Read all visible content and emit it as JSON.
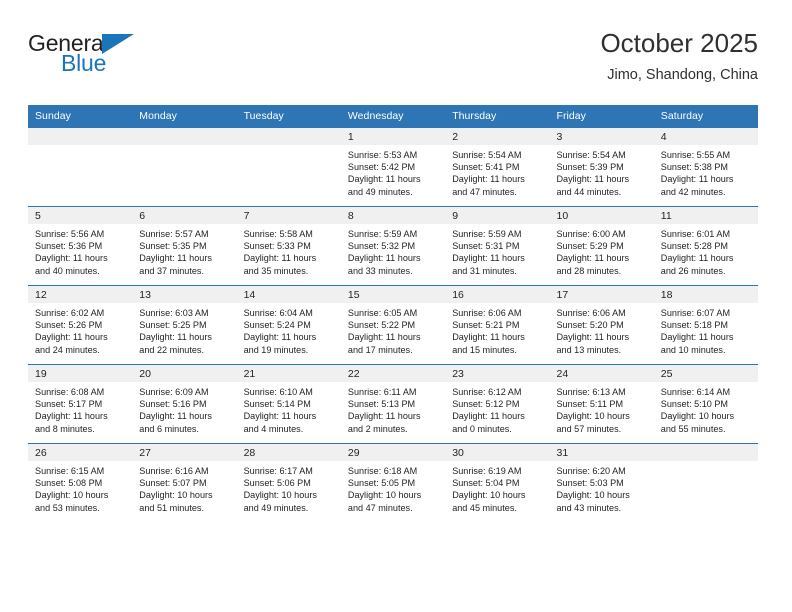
{
  "brand": {
    "name_top": "General",
    "name_bottom": "Blue"
  },
  "header": {
    "title": "October 2025",
    "location": "Jimo, Shandong, China"
  },
  "colors": {
    "header_blue": "#2e75b6",
    "brand_blue": "#1b75bb",
    "daynum_band": "#f0f0f0",
    "text": "#231f20"
  },
  "calendar": {
    "weekday_headers": [
      "Sunday",
      "Monday",
      "Tuesday",
      "Wednesday",
      "Thursday",
      "Friday",
      "Saturday"
    ],
    "weeks": [
      [
        {
          "day": "",
          "sunrise": "",
          "sunset": "",
          "daylight_line1": "",
          "daylight_line2": ""
        },
        {
          "day": "",
          "sunrise": "",
          "sunset": "",
          "daylight_line1": "",
          "daylight_line2": ""
        },
        {
          "day": "",
          "sunrise": "",
          "sunset": "",
          "daylight_line1": "",
          "daylight_line2": ""
        },
        {
          "day": "1",
          "sunrise": "Sunrise: 5:53 AM",
          "sunset": "Sunset: 5:42 PM",
          "daylight_line1": "Daylight: 11 hours",
          "daylight_line2": "and 49 minutes."
        },
        {
          "day": "2",
          "sunrise": "Sunrise: 5:54 AM",
          "sunset": "Sunset: 5:41 PM",
          "daylight_line1": "Daylight: 11 hours",
          "daylight_line2": "and 47 minutes."
        },
        {
          "day": "3",
          "sunrise": "Sunrise: 5:54 AM",
          "sunset": "Sunset: 5:39 PM",
          "daylight_line1": "Daylight: 11 hours",
          "daylight_line2": "and 44 minutes."
        },
        {
          "day": "4",
          "sunrise": "Sunrise: 5:55 AM",
          "sunset": "Sunset: 5:38 PM",
          "daylight_line1": "Daylight: 11 hours",
          "daylight_line2": "and 42 minutes."
        }
      ],
      [
        {
          "day": "5",
          "sunrise": "Sunrise: 5:56 AM",
          "sunset": "Sunset: 5:36 PM",
          "daylight_line1": "Daylight: 11 hours",
          "daylight_line2": "and 40 minutes."
        },
        {
          "day": "6",
          "sunrise": "Sunrise: 5:57 AM",
          "sunset": "Sunset: 5:35 PM",
          "daylight_line1": "Daylight: 11 hours",
          "daylight_line2": "and 37 minutes."
        },
        {
          "day": "7",
          "sunrise": "Sunrise: 5:58 AM",
          "sunset": "Sunset: 5:33 PM",
          "daylight_line1": "Daylight: 11 hours",
          "daylight_line2": "and 35 minutes."
        },
        {
          "day": "8",
          "sunrise": "Sunrise: 5:59 AM",
          "sunset": "Sunset: 5:32 PM",
          "daylight_line1": "Daylight: 11 hours",
          "daylight_line2": "and 33 minutes."
        },
        {
          "day": "9",
          "sunrise": "Sunrise: 5:59 AM",
          "sunset": "Sunset: 5:31 PM",
          "daylight_line1": "Daylight: 11 hours",
          "daylight_line2": "and 31 minutes."
        },
        {
          "day": "10",
          "sunrise": "Sunrise: 6:00 AM",
          "sunset": "Sunset: 5:29 PM",
          "daylight_line1": "Daylight: 11 hours",
          "daylight_line2": "and 28 minutes."
        },
        {
          "day": "11",
          "sunrise": "Sunrise: 6:01 AM",
          "sunset": "Sunset: 5:28 PM",
          "daylight_line1": "Daylight: 11 hours",
          "daylight_line2": "and 26 minutes."
        }
      ],
      [
        {
          "day": "12",
          "sunrise": "Sunrise: 6:02 AM",
          "sunset": "Sunset: 5:26 PM",
          "daylight_line1": "Daylight: 11 hours",
          "daylight_line2": "and 24 minutes."
        },
        {
          "day": "13",
          "sunrise": "Sunrise: 6:03 AM",
          "sunset": "Sunset: 5:25 PM",
          "daylight_line1": "Daylight: 11 hours",
          "daylight_line2": "and 22 minutes."
        },
        {
          "day": "14",
          "sunrise": "Sunrise: 6:04 AM",
          "sunset": "Sunset: 5:24 PM",
          "daylight_line1": "Daylight: 11 hours",
          "daylight_line2": "and 19 minutes."
        },
        {
          "day": "15",
          "sunrise": "Sunrise: 6:05 AM",
          "sunset": "Sunset: 5:22 PM",
          "daylight_line1": "Daylight: 11 hours",
          "daylight_line2": "and 17 minutes."
        },
        {
          "day": "16",
          "sunrise": "Sunrise: 6:06 AM",
          "sunset": "Sunset: 5:21 PM",
          "daylight_line1": "Daylight: 11 hours",
          "daylight_line2": "and 15 minutes."
        },
        {
          "day": "17",
          "sunrise": "Sunrise: 6:06 AM",
          "sunset": "Sunset: 5:20 PM",
          "daylight_line1": "Daylight: 11 hours",
          "daylight_line2": "and 13 minutes."
        },
        {
          "day": "18",
          "sunrise": "Sunrise: 6:07 AM",
          "sunset": "Sunset: 5:18 PM",
          "daylight_line1": "Daylight: 11 hours",
          "daylight_line2": "and 10 minutes."
        }
      ],
      [
        {
          "day": "19",
          "sunrise": "Sunrise: 6:08 AM",
          "sunset": "Sunset: 5:17 PM",
          "daylight_line1": "Daylight: 11 hours",
          "daylight_line2": "and 8 minutes."
        },
        {
          "day": "20",
          "sunrise": "Sunrise: 6:09 AM",
          "sunset": "Sunset: 5:16 PM",
          "daylight_line1": "Daylight: 11 hours",
          "daylight_line2": "and 6 minutes."
        },
        {
          "day": "21",
          "sunrise": "Sunrise: 6:10 AM",
          "sunset": "Sunset: 5:14 PM",
          "daylight_line1": "Daylight: 11 hours",
          "daylight_line2": "and 4 minutes."
        },
        {
          "day": "22",
          "sunrise": "Sunrise: 6:11 AM",
          "sunset": "Sunset: 5:13 PM",
          "daylight_line1": "Daylight: 11 hours",
          "daylight_line2": "and 2 minutes."
        },
        {
          "day": "23",
          "sunrise": "Sunrise: 6:12 AM",
          "sunset": "Sunset: 5:12 PM",
          "daylight_line1": "Daylight: 11 hours",
          "daylight_line2": "and 0 minutes."
        },
        {
          "day": "24",
          "sunrise": "Sunrise: 6:13 AM",
          "sunset": "Sunset: 5:11 PM",
          "daylight_line1": "Daylight: 10 hours",
          "daylight_line2": "and 57 minutes."
        },
        {
          "day": "25",
          "sunrise": "Sunrise: 6:14 AM",
          "sunset": "Sunset: 5:10 PM",
          "daylight_line1": "Daylight: 10 hours",
          "daylight_line2": "and 55 minutes."
        }
      ],
      [
        {
          "day": "26",
          "sunrise": "Sunrise: 6:15 AM",
          "sunset": "Sunset: 5:08 PM",
          "daylight_line1": "Daylight: 10 hours",
          "daylight_line2": "and 53 minutes."
        },
        {
          "day": "27",
          "sunrise": "Sunrise: 6:16 AM",
          "sunset": "Sunset: 5:07 PM",
          "daylight_line1": "Daylight: 10 hours",
          "daylight_line2": "and 51 minutes."
        },
        {
          "day": "28",
          "sunrise": "Sunrise: 6:17 AM",
          "sunset": "Sunset: 5:06 PM",
          "daylight_line1": "Daylight: 10 hours",
          "daylight_line2": "and 49 minutes."
        },
        {
          "day": "29",
          "sunrise": "Sunrise: 6:18 AM",
          "sunset": "Sunset: 5:05 PM",
          "daylight_line1": "Daylight: 10 hours",
          "daylight_line2": "and 47 minutes."
        },
        {
          "day": "30",
          "sunrise": "Sunrise: 6:19 AM",
          "sunset": "Sunset: 5:04 PM",
          "daylight_line1": "Daylight: 10 hours",
          "daylight_line2": "and 45 minutes."
        },
        {
          "day": "31",
          "sunrise": "Sunrise: 6:20 AM",
          "sunset": "Sunset: 5:03 PM",
          "daylight_line1": "Daylight: 10 hours",
          "daylight_line2": "and 43 minutes."
        },
        {
          "day": "",
          "sunrise": "",
          "sunset": "",
          "daylight_line1": "",
          "daylight_line2": ""
        }
      ]
    ]
  }
}
